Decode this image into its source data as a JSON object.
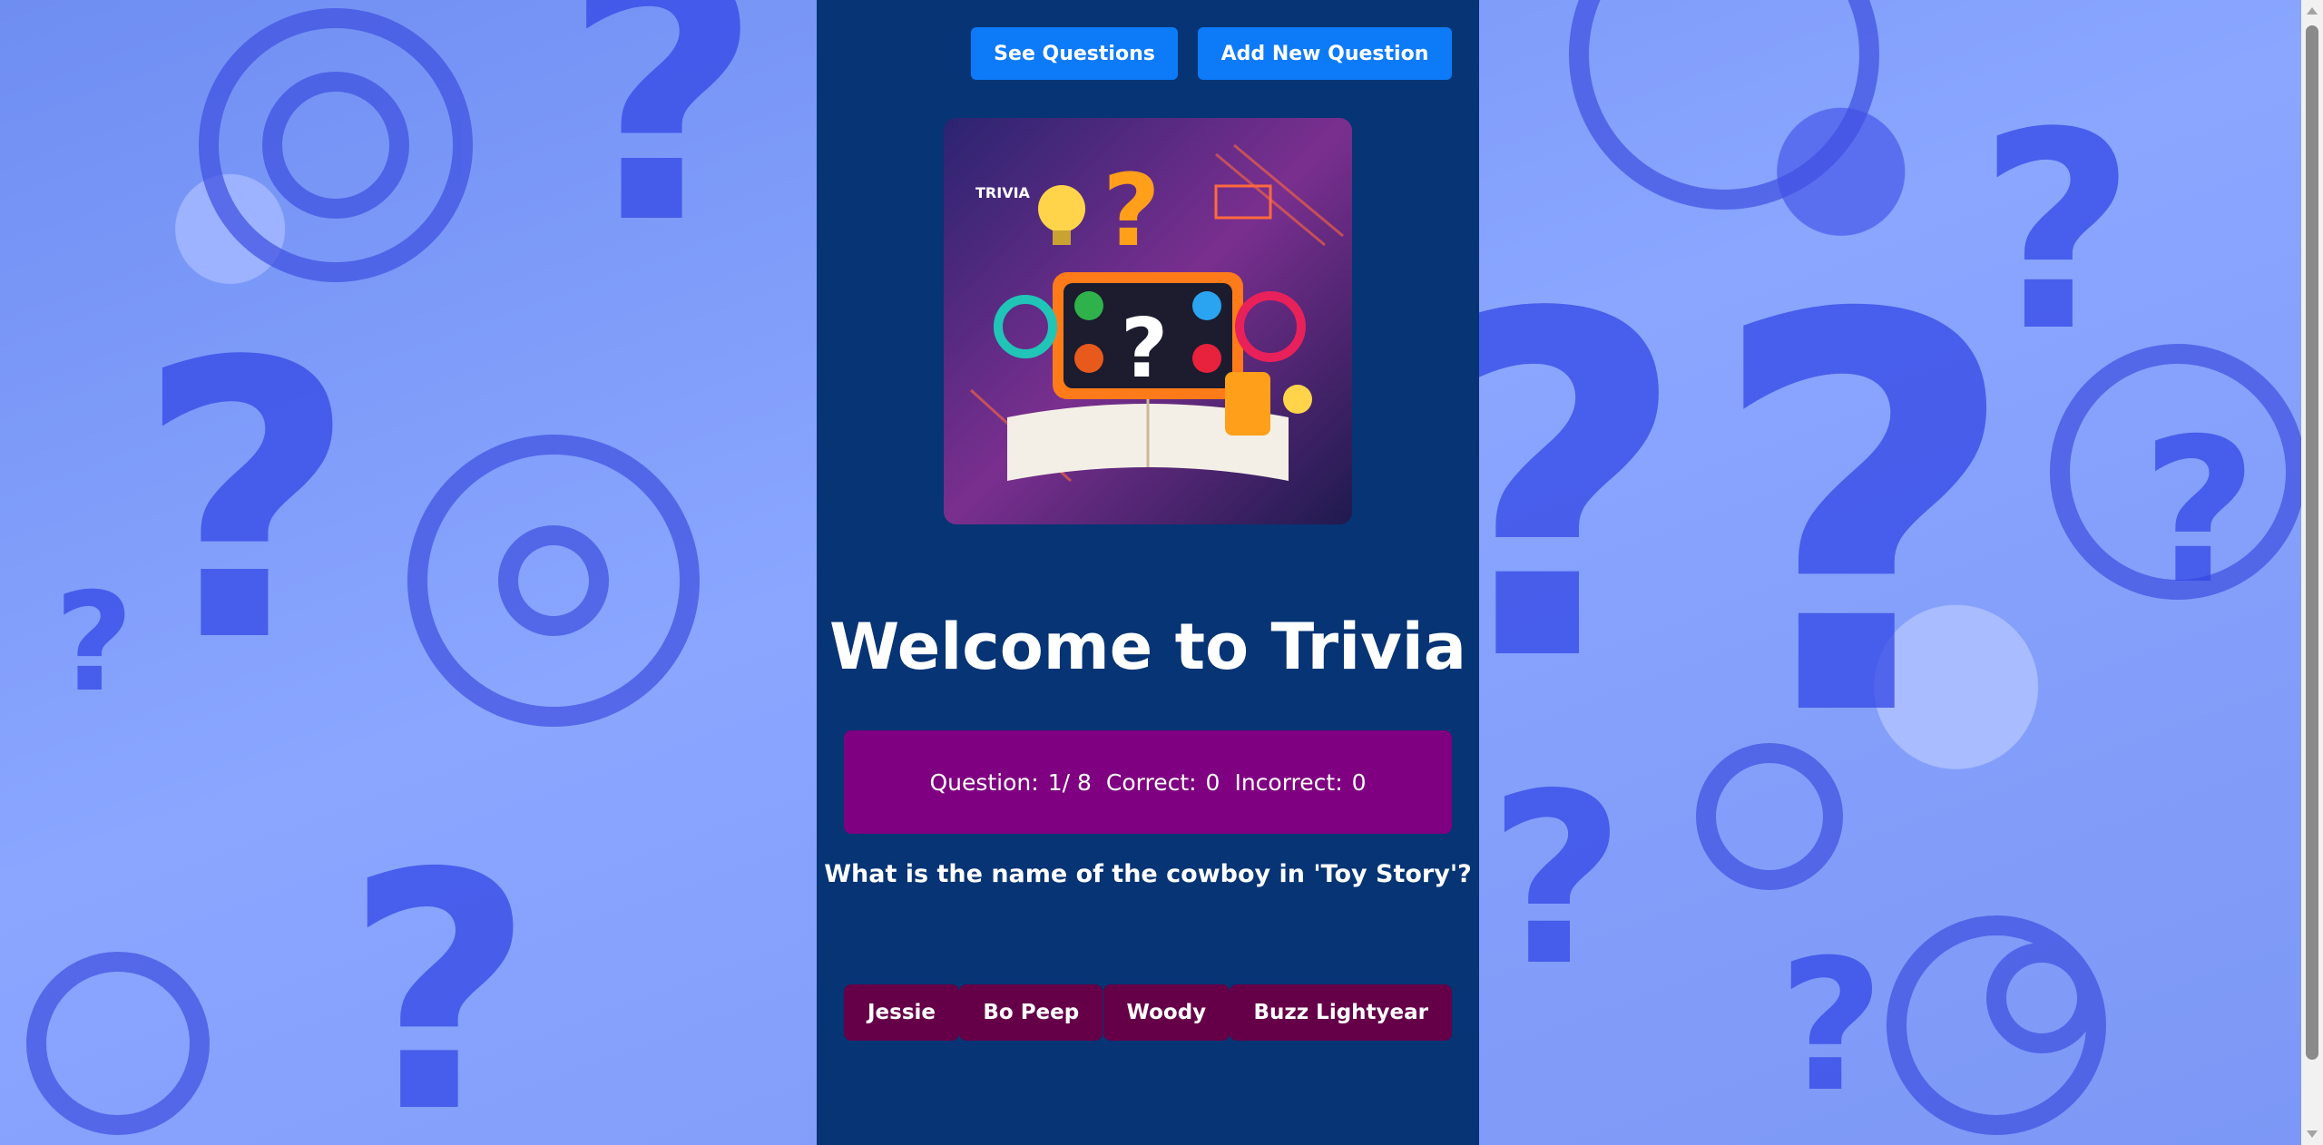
{
  "nav": {
    "see_questions_label": "See Questions",
    "add_question_label": "Add New Question"
  },
  "hero": {
    "image_semantic": "trivia-illustration",
    "image_text": "TRIVIA"
  },
  "page_title": "Welcome to Trivia",
  "status": {
    "question_label": "Question:",
    "question_value": "1/ 8",
    "correct_label": "Correct:",
    "correct_value": "0",
    "incorrect_label": "Incorrect:",
    "incorrect_value": "0"
  },
  "question_text": "What is the name of the cowboy in 'Toy Story'?",
  "answers": [
    "Jessie",
    "Bo Peep",
    "Woody",
    "Buzz Lightyear"
  ],
  "colors": {
    "panel": "#063474",
    "primary_button": "#0d7af7",
    "status_bar": "#7f0080",
    "answer_button": "#650048",
    "background": "#7f9cf2"
  }
}
